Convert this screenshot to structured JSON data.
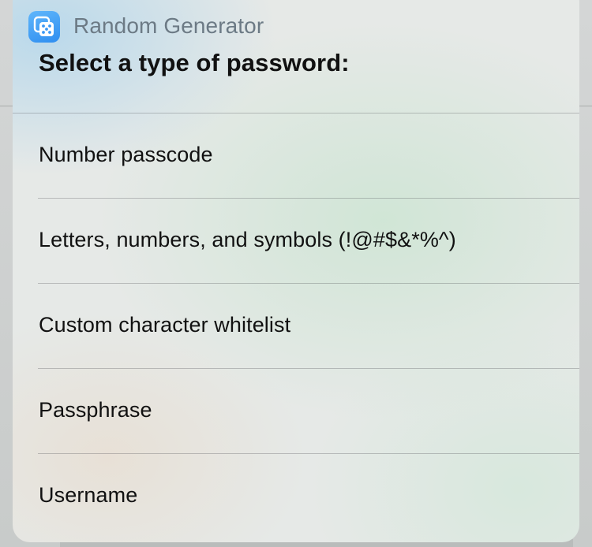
{
  "app": {
    "name": "Random Generator",
    "icon": "dice-icon",
    "accent_color": "#3a98f5"
  },
  "prompt": {
    "title": "Select a type of password:"
  },
  "options": [
    {
      "label": "Number passcode"
    },
    {
      "label": "Letters, numbers, and symbols (!@#$&*%^)"
    },
    {
      "label": "Custom character whitelist"
    },
    {
      "label": "Passphrase"
    },
    {
      "label": "Username"
    }
  ]
}
